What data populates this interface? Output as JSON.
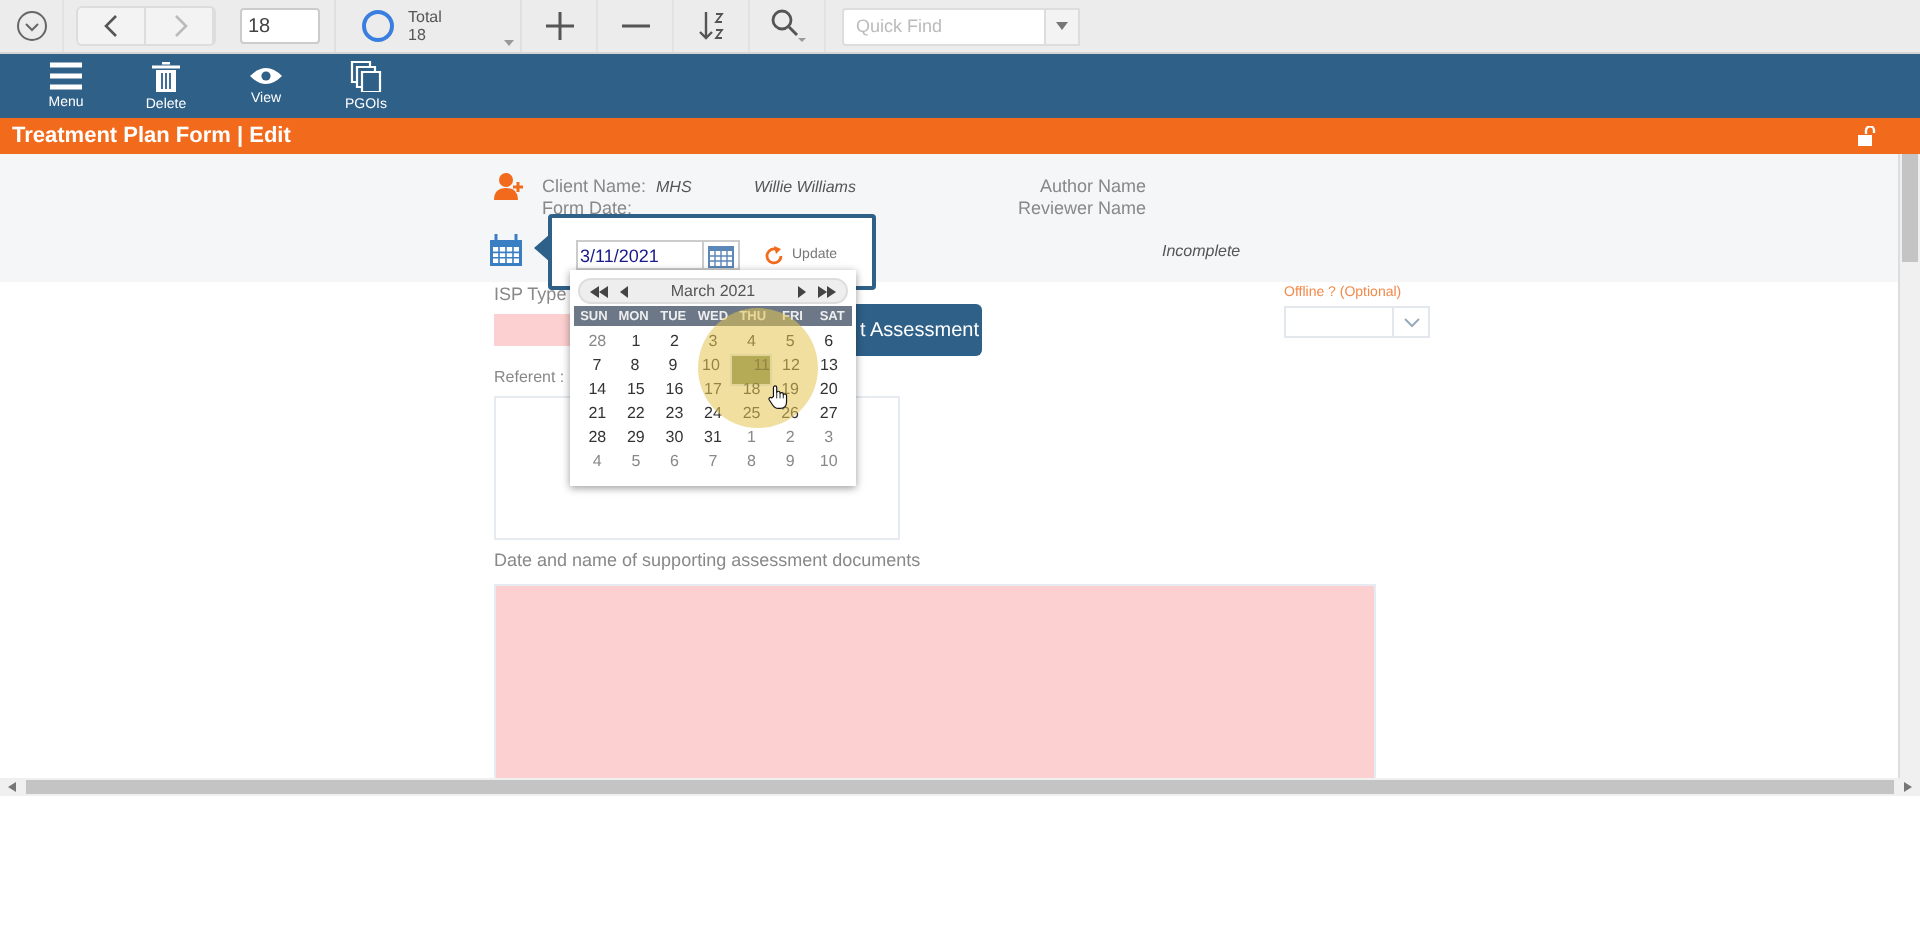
{
  "toolbar": {
    "page": "18",
    "total_label": "Total",
    "total_value": "18",
    "quick_find": {
      "placeholder": "Quick Find"
    }
  },
  "ribbon": [
    {
      "kind": "menu",
      "label": "Menu"
    },
    {
      "kind": "delete",
      "label": "Delete"
    },
    {
      "kind": "view",
      "label": "View"
    },
    {
      "kind": "pages",
      "label": "PGOIs"
    }
  ],
  "title_bar": {
    "title": "Treatment Plan Form | Edit"
  },
  "header": {
    "client_label": "Client Name:",
    "client_org": "MHS",
    "client_name": "Willie Williams",
    "author_label": "Author Name",
    "form_date_label": "Form Date:",
    "reviewer_label": "Reviewer Name",
    "status": "Incomplete"
  },
  "form": {
    "isp_label": "ISP Type",
    "assessment_button": "t Assessment",
    "offline_label": "Offline ? (Optional)",
    "referent_label": "Referent :",
    "documents_label": "Date and name of supporting assessment documents"
  },
  "date_picker": {
    "value": "3/11/2021",
    "update": "Update",
    "month": "March 2021",
    "weekdays": [
      "SUN",
      "MON",
      "TUE",
      "WED",
      "THU",
      "FRI",
      "SAT"
    ],
    "weeks": [
      [
        {
          "day": "28",
          "other_month": true,
          "selected": false
        },
        {
          "day": "1",
          "other_month": false,
          "selected": false
        },
        {
          "day": "2",
          "other_month": false,
          "selected": false
        },
        {
          "day": "3",
          "other_month": false,
          "selected": false
        },
        {
          "day": "4",
          "other_month": false,
          "selected": false
        },
        {
          "day": "5",
          "other_month": false,
          "selected": false
        },
        {
          "day": "6",
          "other_month": false,
          "selected": false
        }
      ],
      [
        {
          "day": "7",
          "other_month": false,
          "selected": false
        },
        {
          "day": "8",
          "other_month": false,
          "selected": false
        },
        {
          "day": "9",
          "other_month": false,
          "selected": false
        },
        {
          "day": "10",
          "other_month": false,
          "selected": false
        },
        {
          "day": "11",
          "other_month": false,
          "selected": true
        },
        {
          "day": "12",
          "other_month": false,
          "selected": false
        },
        {
          "day": "13",
          "other_month": false,
          "selected": false
        }
      ],
      [
        {
          "day": "14",
          "other_month": false,
          "selected": false
        },
        {
          "day": "15",
          "other_month": false,
          "selected": false
        },
        {
          "day": "16",
          "other_month": false,
          "selected": false
        },
        {
          "day": "17",
          "other_month": false,
          "selected": false
        },
        {
          "day": "18",
          "other_month": false,
          "selected": false
        },
        {
          "day": "19",
          "other_month": false,
          "selected": false
        },
        {
          "day": "20",
          "other_month": false,
          "selected": false
        }
      ],
      [
        {
          "day": "21",
          "other_month": false,
          "selected": false
        },
        {
          "day": "22",
          "other_month": false,
          "selected": false
        },
        {
          "day": "23",
          "other_month": false,
          "selected": false
        },
        {
          "day": "24",
          "other_month": false,
          "selected": false
        },
        {
          "day": "25",
          "other_month": false,
          "selected": false
        },
        {
          "day": "26",
          "other_month": false,
          "selected": false
        },
        {
          "day": "27",
          "other_month": false,
          "selected": false
        }
      ],
      [
        {
          "day": "28",
          "other_month": false,
          "selected": false
        },
        {
          "day": "29",
          "other_month": false,
          "selected": false
        },
        {
          "day": "30",
          "other_month": false,
          "selected": false
        },
        {
          "day": "31",
          "other_month": false,
          "selected": false
        },
        {
          "day": "1",
          "other_month": true,
          "selected": false
        },
        {
          "day": "2",
          "other_month": true,
          "selected": false
        },
        {
          "day": "3",
          "other_month": true,
          "selected": false
        }
      ],
      [
        {
          "day": "4",
          "other_month": true,
          "selected": false
        },
        {
          "day": "5",
          "other_month": true,
          "selected": false
        },
        {
          "day": "6",
          "other_month": true,
          "selected": false
        },
        {
          "day": "7",
          "other_month": true,
          "selected": false
        },
        {
          "day": "8",
          "other_month": true,
          "selected": false
        },
        {
          "day": "9",
          "other_month": true,
          "selected": false
        },
        {
          "day": "10",
          "other_month": true,
          "selected": false
        }
      ]
    ]
  }
}
